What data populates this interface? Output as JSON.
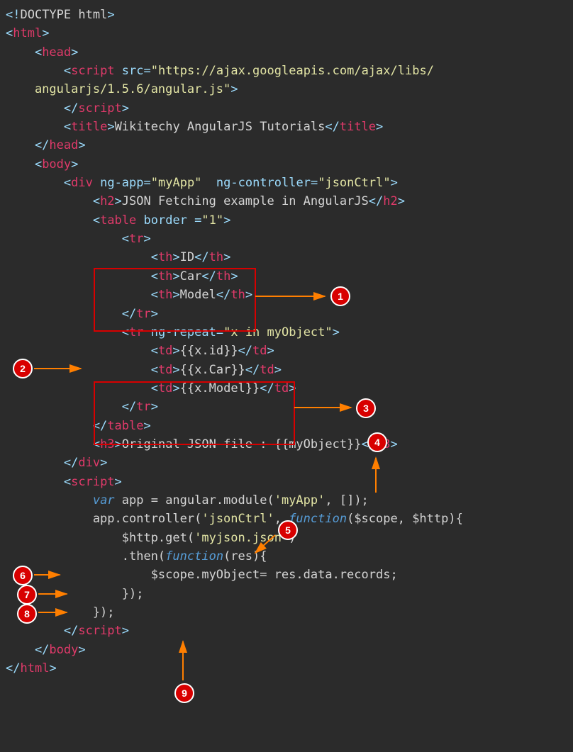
{
  "code": {
    "l01_a": "<!",
    "l01_b": "DOCTYPE html",
    "l01_c": ">",
    "l02_a": "<",
    "l02_b": "html",
    "l02_c": ">",
    "l03_a": "    <",
    "l03_b": "head",
    "l03_c": ">",
    "l04_a": "        <",
    "l04_b": "script",
    "l04_c": " ",
    "l04_d": "src",
    "l04_e": "=",
    "l04_f": "\"https://ajax.googleapis.com/ajax/libs/",
    "l05_a": "    angularjs/1.5.6/angular.js\"",
    "l05_b": ">",
    "l06_a": "        </",
    "l06_b": "script",
    "l06_c": ">",
    "l07_a": "        <",
    "l07_b": "title",
    "l07_c": ">",
    "l07_d": "Wikitechy AngularJS Tutorials",
    "l07_e": "</",
    "l07_f": "title",
    "l07_g": ">",
    "l08_a": "    </",
    "l08_b": "head",
    "l08_c": ">",
    "l09_a": "    <",
    "l09_b": "body",
    "l09_c": ">",
    "l10_a": "        <",
    "l10_b": "div",
    "l10_c": " ",
    "l10_d": "ng-app",
    "l10_e": "=",
    "l10_f": "\"myApp\"",
    "l10_g": "  ",
    "l10_h": "ng-controller",
    "l10_i": "=",
    "l10_j": "\"jsonCtrl\"",
    "l10_k": ">",
    "l11_a": "            <",
    "l11_b": "h2",
    "l11_c": ">",
    "l11_d": "JSON Fetching example in AngularJS",
    "l11_e": "</",
    "l11_f": "h2",
    "l11_g": ">",
    "l12_a": "            <",
    "l12_b": "table",
    "l12_c": " ",
    "l12_d": "border ",
    "l12_e": "=",
    "l12_f": "\"1\"",
    "l12_g": ">",
    "l13_a": "                <",
    "l13_b": "tr",
    "l13_c": ">",
    "l14_a": "                    <",
    "l14_b": "th",
    "l14_c": ">",
    "l14_d": "ID",
    "l14_e": "</",
    "l14_f": "th",
    "l14_g": ">",
    "l15_a": "                    <",
    "l15_b": "th",
    "l15_c": ">",
    "l15_d": "Car",
    "l15_e": "</",
    "l15_f": "th",
    "l15_g": ">",
    "l16_a": "                    <",
    "l16_b": "th",
    "l16_c": ">",
    "l16_d": "Model",
    "l16_e": "</",
    "l16_f": "th",
    "l16_g": ">",
    "l17_a": "                </",
    "l17_b": "tr",
    "l17_c": ">",
    "l18_a": "                <",
    "l18_b": "tr",
    "l18_c": " ",
    "l18_d": "ng-repeat",
    "l18_e": "=",
    "l18_f": "\"x in myObject\"",
    "l18_g": ">",
    "l19_a": "                    <",
    "l19_b": "td",
    "l19_c": ">",
    "l19_d": "{{x.id}}",
    "l19_e": "</",
    "l19_f": "td",
    "l19_g": ">",
    "l20_a": "                    <",
    "l20_b": "td",
    "l20_c": ">",
    "l20_d": "{{x.Car}}",
    "l20_e": "</",
    "l20_f": "td",
    "l20_g": ">",
    "l21_a": "                    <",
    "l21_b": "td",
    "l21_c": ">",
    "l21_d": "{{x.Model}}",
    "l21_e": "</",
    "l21_f": "td",
    "l21_g": ">",
    "l22_a": "                </",
    "l22_b": "tr",
    "l22_c": ">",
    "l23_a": "            </",
    "l23_b": "table",
    "l23_c": ">",
    "l24_a": "            <",
    "l24_b": "h3",
    "l24_c": ">",
    "l24_d": "Original JSON file : {{myObject}}",
    "l24_e": "</",
    "l24_f": "h3",
    "l24_g": ">",
    "l25_a": "        </",
    "l25_b": "div",
    "l25_c": ">",
    "l26_a": "        <",
    "l26_b": "script",
    "l26_c": ">",
    "l27_a": "            ",
    "l27_b": "var",
    "l27_c": " app = angular.module(",
    "l27_d": "'myApp'",
    "l27_e": ", []);",
    "l28_a": "            app.controller(",
    "l28_b": "'jsonCtrl'",
    "l28_c": ", ",
    "l28_d": "function",
    "l28_e": "($scope, $http){",
    "l29_a": "                $http.get(",
    "l29_b": "'myjson.json'",
    "l29_c": ")",
    "l30_a": "                .then(",
    "l30_b": "function",
    "l30_c": "(res){",
    "l31_a": "                    $scope.myObject= res.data.records;",
    "l32_a": "                });",
    "l33_a": "            });",
    "l34_a": "        </",
    "l34_b": "script",
    "l34_c": ">",
    "l35_a": "    </",
    "l35_b": "body",
    "l35_c": ">",
    "l36_a": "</",
    "l36_b": "html",
    "l36_c": ">"
  },
  "annotations": {
    "b1": "1",
    "b2": "2",
    "b3": "3",
    "b4": "4",
    "b5": "5",
    "b6": "6",
    "b7": "7",
    "b8": "8",
    "b9": "9"
  }
}
